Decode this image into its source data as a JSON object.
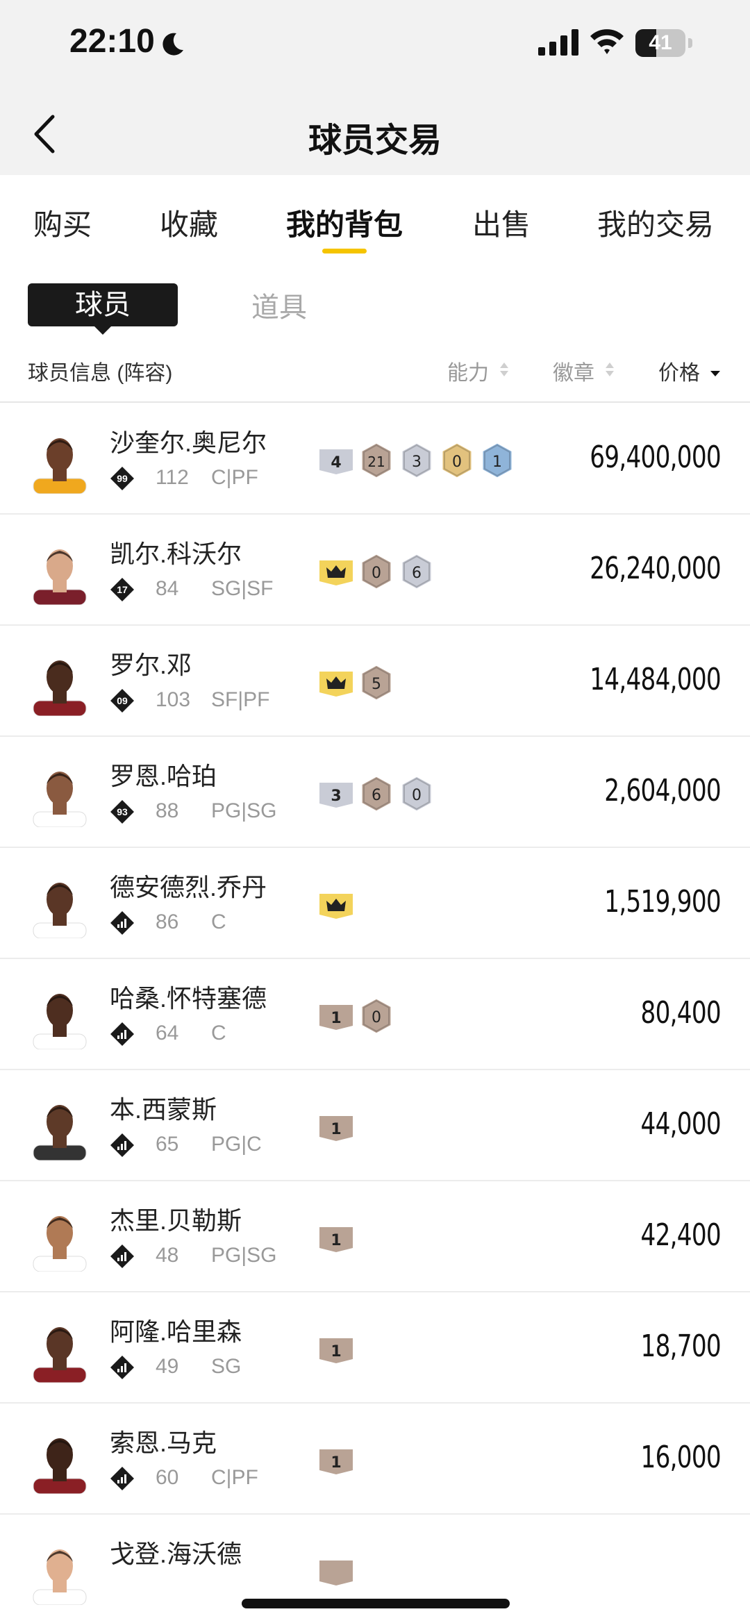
{
  "status_bar": {
    "time": "22:10",
    "battery": "41",
    "battery_level": 0.41
  },
  "header": {
    "title": "球员交易"
  },
  "tabs": [
    {
      "label": "购买"
    },
    {
      "label": "收藏"
    },
    {
      "label": "我的背包",
      "active": true
    },
    {
      "label": "出售"
    },
    {
      "label": "我的交易"
    }
  ],
  "segment": {
    "active": "球员",
    "other": "道具"
  },
  "columns": {
    "info": "球员信息 (阵容)",
    "ability": "能力",
    "badge": "徽章",
    "price": "价格"
  },
  "colors": {
    "accent": "#f5c400",
    "badge_gray": "#c9ccd6",
    "badge_bronze": "#b9a395",
    "badge_gold": "#e2c27e",
    "badge_blue": "#8fb4d9",
    "crown_yellow": "#f3d35b"
  },
  "players": [
    {
      "name": "沙奎尔.奥尼尔",
      "rank": "99",
      "ovr": "112",
      "pos": "C|PF",
      "skin": "#6b3f2a",
      "jersey": "#f0a81e",
      "price": "69,400,000",
      "badges": [
        {
          "type": "tag",
          "color": "gray",
          "label": "4"
        },
        {
          "type": "hex",
          "color": "bronze",
          "label": "21"
        },
        {
          "type": "hex",
          "color": "gray",
          "label": "3"
        },
        {
          "type": "hex",
          "color": "gold",
          "label": "0"
        },
        {
          "type": "hex",
          "color": "blue",
          "label": "1"
        }
      ]
    },
    {
      "name": "凯尔.科沃尔",
      "rank": "17",
      "ovr": "84",
      "pos": "SG|SF",
      "skin": "#d9a98a",
      "jersey": "#7a1f2b",
      "price": "26,240,000",
      "badges": [
        {
          "type": "crown",
          "color": "crown",
          "label": ""
        },
        {
          "type": "hex",
          "color": "bronze",
          "label": "0"
        },
        {
          "type": "hex",
          "color": "gray",
          "label": "6"
        }
      ]
    },
    {
      "name": "罗尔.邓",
      "rank": "09",
      "ovr": "103",
      "pos": "SF|PF",
      "skin": "#4a2c1e",
      "jersey": "#8a1f25",
      "price": "14,484,000",
      "badges": [
        {
          "type": "crown",
          "color": "crown",
          "label": ""
        },
        {
          "type": "hex",
          "color": "bronze",
          "label": "5"
        }
      ]
    },
    {
      "name": "罗恩.哈珀",
      "rank": "93",
      "ovr": "88",
      "pos": "PG|SG",
      "skin": "#8a5a40",
      "jersey": "#ffffff",
      "price": "2,604,000",
      "badges": [
        {
          "type": "tag",
          "color": "gray",
          "label": "3"
        },
        {
          "type": "hex",
          "color": "bronze",
          "label": "6"
        },
        {
          "type": "hex",
          "color": "gray",
          "label": "0"
        }
      ]
    },
    {
      "name": "德安德烈.乔丹",
      "rank": "",
      "ovr": "86",
      "pos": "C",
      "skin": "#5a3626",
      "jersey": "#ffffff",
      "price": "1,519,900",
      "badges": [
        {
          "type": "crown",
          "color": "crown",
          "label": ""
        }
      ]
    },
    {
      "name": "哈桑.怀特塞德",
      "rank": "",
      "ovr": "64",
      "pos": "C",
      "skin": "#4e2e20",
      "jersey": "#ffffff",
      "price": "80,400",
      "badges": [
        {
          "type": "tag",
          "color": "bronze",
          "label": "1"
        },
        {
          "type": "hex",
          "color": "bronze",
          "label": "0"
        }
      ]
    },
    {
      "name": "本.西蒙斯",
      "rank": "",
      "ovr": "65",
      "pos": "PG|C",
      "skin": "#5e3a28",
      "jersey": "#333333",
      "price": "44,000",
      "badges": [
        {
          "type": "tag",
          "color": "bronze",
          "label": "1"
        }
      ]
    },
    {
      "name": "杰里.贝勒斯",
      "rank": "",
      "ovr": "48",
      "pos": "PG|SG",
      "skin": "#b07a55",
      "jersey": "#ffffff",
      "price": "42,400",
      "badges": [
        {
          "type": "tag",
          "color": "bronze",
          "label": "1"
        }
      ]
    },
    {
      "name": "阿隆.哈里森",
      "rank": "",
      "ovr": "49",
      "pos": "SG",
      "skin": "#5a3626",
      "jersey": "#8a1f25",
      "price": "18,700",
      "badges": [
        {
          "type": "tag",
          "color": "bronze",
          "label": "1"
        }
      ]
    },
    {
      "name": "索恩.马克",
      "rank": "",
      "ovr": "60",
      "pos": "C|PF",
      "skin": "#3e2419",
      "jersey": "#8a1f25",
      "price": "16,000",
      "badges": [
        {
          "type": "tag",
          "color": "bronze",
          "label": "1"
        }
      ]
    },
    {
      "name": "戈登.海沃德",
      "rank": "",
      "ovr": "",
      "pos": "",
      "skin": "#e0b090",
      "jersey": "#ffffff",
      "price": "",
      "badges": [
        {
          "type": "tag",
          "color": "bronze",
          "label": ""
        }
      ]
    }
  ]
}
